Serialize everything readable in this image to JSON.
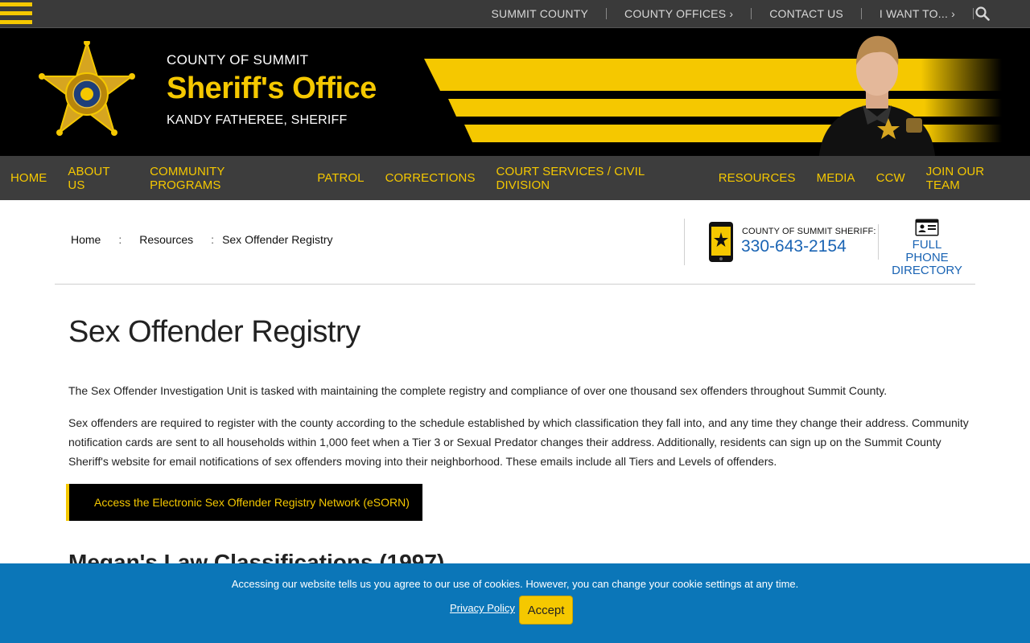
{
  "utility_nav": {
    "items": [
      "SUMMIT COUNTY",
      "COUNTY OFFICES ›",
      "CONTACT US",
      "I WANT TO... ›"
    ]
  },
  "header": {
    "county": "COUNTY OF SUMMIT",
    "office": "Sheriff's Office",
    "sheriff": "KANDY FATHEREE, SHERIFF"
  },
  "main_nav": {
    "items": [
      "HOME",
      "ABOUT US",
      "COMMUNITY PROGRAMS",
      "PATROL",
      "CORRECTIONS",
      "COURT SERVICES / CIVIL DIVISION",
      "RESOURCES",
      "MEDIA",
      "CCW",
      "JOIN OUR TEAM"
    ]
  },
  "breadcrumb": {
    "items": [
      "Home",
      "Resources",
      "Sex Offender Registry"
    ],
    "separator": ":"
  },
  "contact": {
    "label": "COUNTY OF SUMMIT SHERIFF:",
    "phone": "330-643-2154",
    "directory_line1": "FULL PHONE",
    "directory_line2": "DIRECTORY"
  },
  "content": {
    "title": "Sex Offender Registry",
    "para1": "The Sex Offender Investigation Unit is tasked with maintaining the complete registry and compliance of over one thousand sex offenders throughout Summit County.",
    "para2": "Sex offenders are required to register with the county according to the schedule established by which classification they fall into, and any time they change their address. Community notification cards are sent to all households within 1,000 feet when a Tier 3 or Sexual Predator changes their address. Additionally, residents can sign up on the Summit County Sheriff's website for email notifications of sex offenders moving into their neighborhood. These emails include all Tiers and Levels of offenders.",
    "esorn_button": "Access the Electronic Sex Offender Registry Network (eSORN)",
    "subheading": "Megan's Law Classifications (1997)"
  },
  "cookie": {
    "message": "Accessing our website tells us you agree to our use of cookies. However, you can change your cookie settings at any time.",
    "privacy_label": "Privacy Policy",
    "accept_label": "Accept"
  },
  "colors": {
    "accent_yellow": "#f5c800",
    "link_blue": "#1a64b4",
    "cookie_blue": "#0b76b8",
    "nav_gray": "#3d3d3d"
  },
  "icons": [
    "menu-icon",
    "search-icon",
    "sheriff-badge-logo",
    "phone-icon",
    "id-card-icon"
  ]
}
